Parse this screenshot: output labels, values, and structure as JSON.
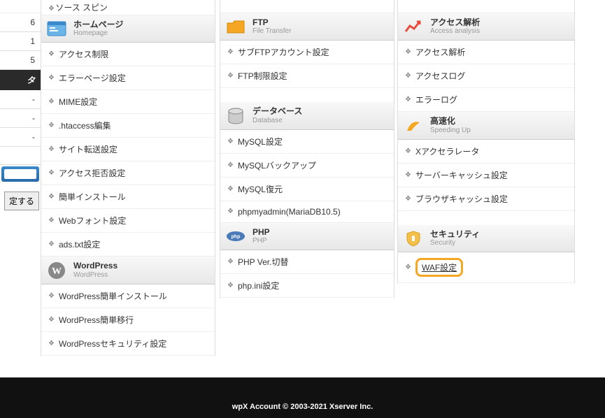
{
  "left": {
    "rows": [
      "6",
      "1",
      "5"
    ],
    "dark_label": "タ",
    "dashes": [
      "-",
      "-",
      "-"
    ],
    "set_button": "定する"
  },
  "cols": {
    "homepage": {
      "jp": "ホームページ",
      "en": "Homepage",
      "truncated_top": "ソース スピン",
      "items": [
        "アクセス制限",
        "エラーページ設定",
        "MIME設定",
        ".htaccess編集",
        "サイト転送設定",
        "アクセス拒否設定",
        "簡単インストール",
        "Webフォント設定",
        "ads.txt設定"
      ]
    },
    "wordpress": {
      "jp": "WordPress",
      "en": "WordPress",
      "items": [
        "WordPress簡単インストール",
        "WordPress簡単移行",
        "WordPressセキュリティ設定"
      ]
    },
    "ftp": {
      "jp": "FTP",
      "en": "File Transfer",
      "items": [
        "サブFTPアカウント設定",
        "FTP制限設定"
      ]
    },
    "database": {
      "jp": "データベース",
      "en": "Database",
      "items": [
        "MySQL設定",
        "MySQLバックアップ",
        "MySQL復元",
        "phpmyadmin(MariaDB10.5)"
      ]
    },
    "php": {
      "jp": "PHP",
      "en": "PHP",
      "items": [
        "PHP Ver.切替",
        "php.ini設定"
      ]
    },
    "access": {
      "jp": "アクセス解析",
      "en": "Access analysis",
      "items": [
        "アクセス解析",
        "アクセスログ",
        "エラーログ"
      ]
    },
    "speed": {
      "jp": "高速化",
      "en": "Speeding Up",
      "items": [
        "Xアクセラレータ",
        "サーバーキャッシュ設定",
        "ブラウザキャッシュ設定"
      ]
    },
    "security": {
      "jp": "セキュリティ",
      "en": "Security",
      "items": [
        "WAF設定"
      ]
    }
  },
  "footer": "wpX Account © 2003-2021 Xserver Inc."
}
